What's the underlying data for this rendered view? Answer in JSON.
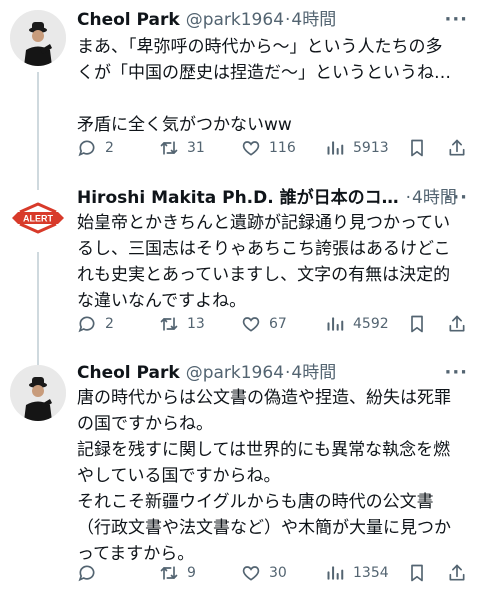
{
  "tweets": [
    {
      "name": "Cheol Park",
      "handle": "@park1964",
      "separator": "·",
      "time": "4時間",
      "more": "···",
      "lines": [
        "まあ、「卑弥呼の時代から〜」という人たちの多",
        "くが「中国の歴史は捏造だ〜」というというね…",
        "",
        "矛盾に全く気がつかないww"
      ],
      "replies": "2",
      "reposts": "31",
      "likes": "116",
      "views": "5913"
    },
    {
      "name": "Hiroshi Makita Ph.D. 誰が日本のコ…",
      "handle": "",
      "separator": "·",
      "time": "4時間",
      "more": "···",
      "avatar_text": "ALERT",
      "lines": [
        "始皇帝とかきちんと遺跡が記録通り見つかってい",
        "るし、三国志はそりゃあちこち誇張はあるけどこ",
        "れも史実とあっていますし、文字の有無は決定的",
        "な違いなんですよね。"
      ],
      "replies": "2",
      "reposts": "13",
      "likes": "67",
      "views": "4592"
    },
    {
      "name": "Cheol Park",
      "handle": "@park1964",
      "separator": "·",
      "time": "4時間",
      "more": "···",
      "lines": [
        "唐の時代からは公文書の偽造や捏造、紛失は死罪",
        "の国ですからね。",
        "記録を残すに関しては世界的にも異常な執念を燃",
        "やしている国ですからね。",
        "それこそ新疆ウイグルからも唐の時代の公文書",
        "（行政文書や法文書など）や木簡が大量に見つか",
        "ってますから。"
      ],
      "replies": "",
      "reposts": "9",
      "likes": "30",
      "views": "1354"
    }
  ],
  "colors": {
    "text": "#0f1419",
    "secondary": "#536471",
    "thread_line": "#cfd9de",
    "alert_red": "#d83a2a"
  },
  "icons": [
    "reply-icon",
    "repost-icon",
    "like-icon",
    "views-icon",
    "bookmark-icon",
    "share-icon"
  ]
}
